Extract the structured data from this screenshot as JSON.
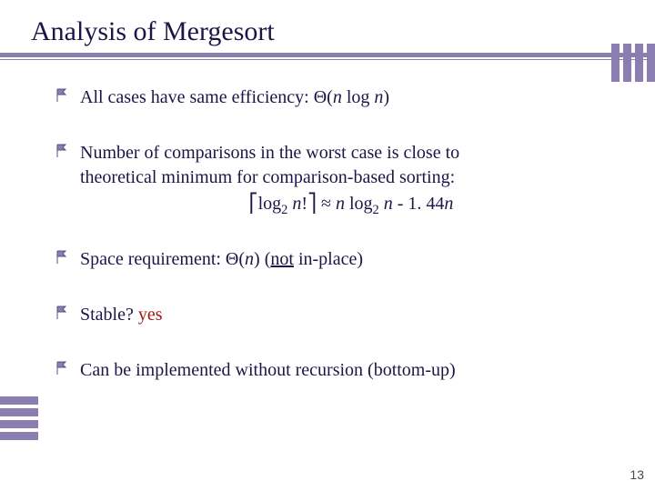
{
  "title": "Analysis of Mergesort",
  "bullets": {
    "b1": {
      "prefix": "All cases have same efficiency: Θ(",
      "n1": "n",
      "mid": " log ",
      "n2": "n",
      "suffix": ")"
    },
    "b2": {
      "line1": "Number of comparisons in the worst case is close to",
      "line2": "theoretical minimum for comparison-based sorting:",
      "formula": {
        "lceil": "⎡",
        "log": "log",
        "sub2a": "2",
        "sp1": " ",
        "nfact": "n",
        "bang": "!",
        "rceil": "⎤",
        "approx": "  ≈   ",
        "n1": "n",
        "sp2": " log",
        "sub2b": "2",
        "sp3": " ",
        "n2": "n",
        "minus": "  - 1. 44",
        "n3": "n"
      }
    },
    "b3": {
      "prefix": "Space requirement: Θ(",
      "n": "n",
      "mid": ") (",
      "not": "not",
      "suffix": " in-place)"
    },
    "b4": {
      "label": "Stable? ",
      "yes": "yes"
    },
    "b5": "Can be implemented without recursion (bottom-up)"
  },
  "page_number": "13"
}
